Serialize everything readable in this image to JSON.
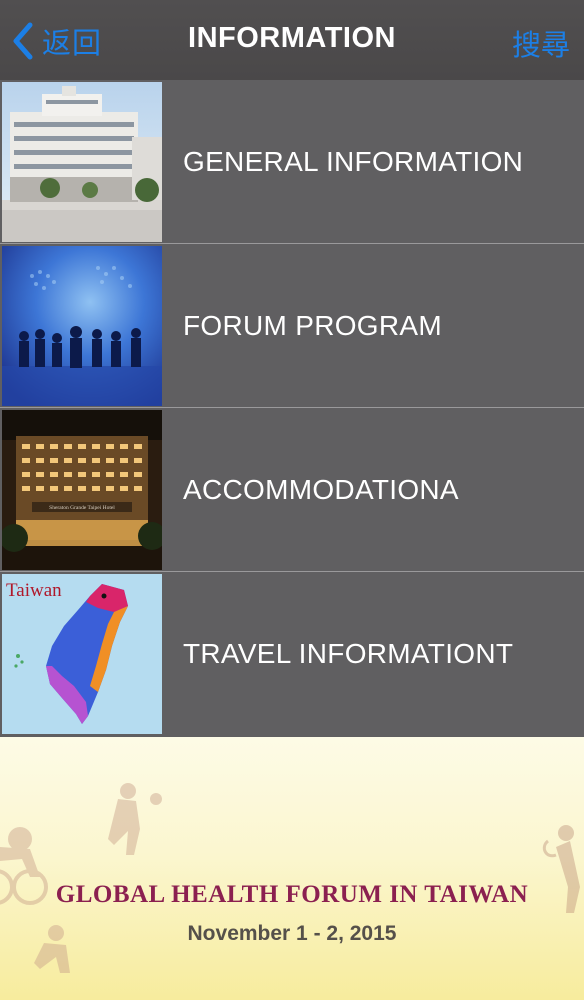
{
  "nav": {
    "back_label": "返回",
    "title": "INFORMATION",
    "search_label": "搜尋",
    "accent_color": "#1c7fe6"
  },
  "menu": {
    "items": [
      {
        "label": "GENERAL INFORMATION",
        "thumbnail": "campus-building-photo"
      },
      {
        "label": "FORUM PROGRAM",
        "thumbnail": "business-silhouettes-photo"
      },
      {
        "label": "ACCOMMODATIONA",
        "thumbnail": "hotel-at-night-photo",
        "thumb_caption": "Sheraton Grande Taipei Hotel"
      },
      {
        "label": "TRAVEL INFORMATIONT",
        "thumbnail": "taiwan-map-illustration",
        "thumb_caption": "Taiwan"
      }
    ]
  },
  "banner": {
    "title": "GLOBAL HEALTH FORUM IN TAIWAN",
    "date": "November 1 - 2, 2015"
  }
}
